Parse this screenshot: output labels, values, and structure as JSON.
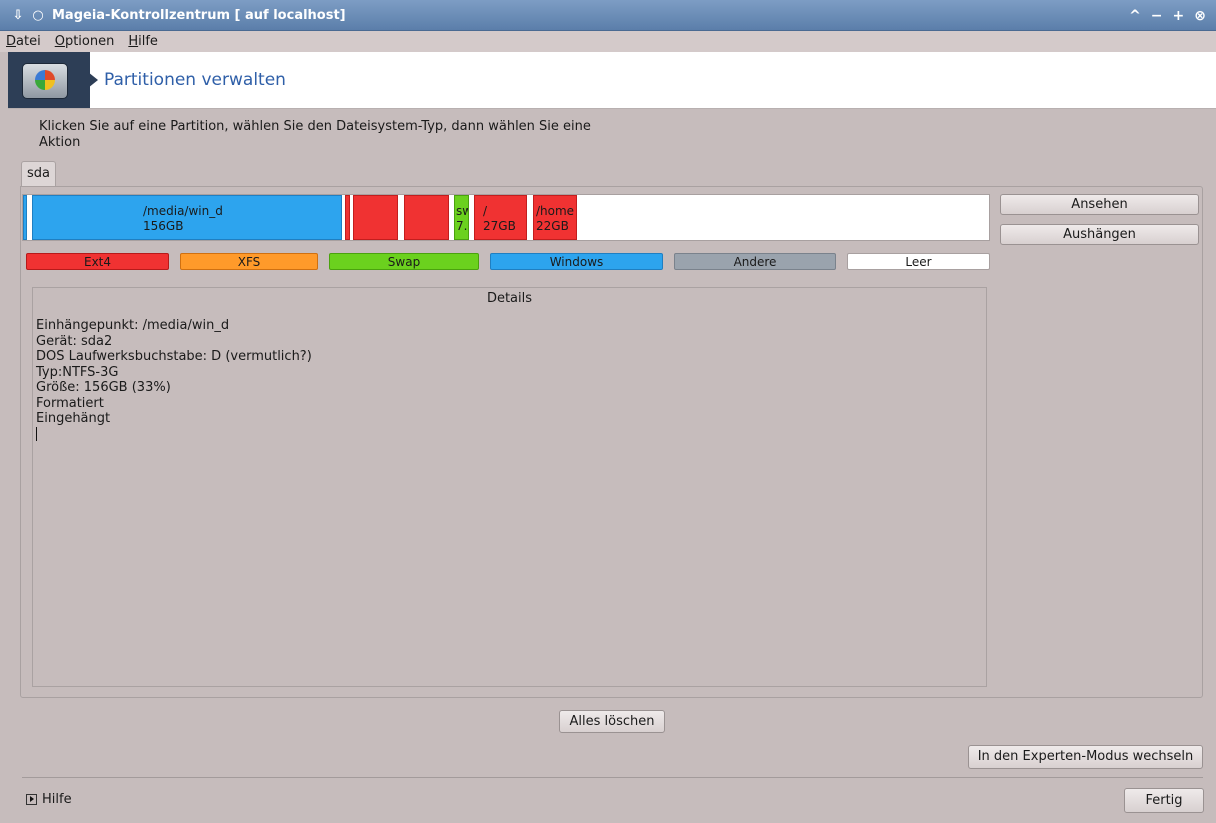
{
  "window": {
    "title": "Mageia-Kontrollzentrum  [ auf localhost]",
    "controls": [
      "^",
      "−",
      "+",
      "⊗"
    ]
  },
  "menu": [
    {
      "label": "Datei"
    },
    {
      "label": "Optionen"
    },
    {
      "label": "Hilfe"
    }
  ],
  "banner": {
    "title": "Partitionen verwalten",
    "icon": "disk-pie-icon"
  },
  "instruction": "Klicken Sie auf eine Partition, wählen Sie den Dateisystem-Typ, dann wählen Sie eine Aktion",
  "disk_tab": "sda",
  "partitions": [
    {
      "line1": "",
      "line2": "",
      "type": "Windows"
    },
    {
      "line1": "/media/win_d",
      "line2": "156GB",
      "type": "Windows"
    },
    {
      "line1": "",
      "line2": "",
      "type": "Ext4"
    },
    {
      "line1": "",
      "line2": "",
      "type": "Ext4"
    },
    {
      "line1": "",
      "line2": "",
      "type": "Ext4"
    },
    {
      "line1": "sw",
      "line2": "7.",
      "type": "Swap"
    },
    {
      "line1": "/",
      "line2": "27GB",
      "type": "Ext4"
    },
    {
      "line1": "/home",
      "line2": "22GB",
      "type": "Ext4"
    },
    {
      "line1": "",
      "line2": "",
      "type": "Leer"
    }
  ],
  "legend": [
    {
      "label": "Ext4",
      "color": "#f03232"
    },
    {
      "label": "XFS",
      "color": "#ff9a2a"
    },
    {
      "label": "Swap",
      "color": "#6bd11e"
    },
    {
      "label": "Windows",
      "color": "#2da4ee"
    },
    {
      "label": "Andere",
      "color": "#9aa3ad"
    },
    {
      "label": "Leer",
      "color": "#ffffff"
    }
  ],
  "actions": {
    "view": "Ansehen",
    "unmount": "Aushängen",
    "clear_all": "Alles löschen",
    "expert_mode": "In den Experten-Modus wechseln",
    "done": "Fertig"
  },
  "details": {
    "title": "Details",
    "lines": [
      "Einhängepunkt: /media/win_d",
      "Gerät: sda2",
      "DOS Laufwerksbuchstabe: D (vermutlich?)",
      "Typ:NTFS-3G",
      "Größe: 156GB (33%)",
      "Formatiert",
      "Eingehängt"
    ]
  },
  "help_toggle": "Hilfe"
}
